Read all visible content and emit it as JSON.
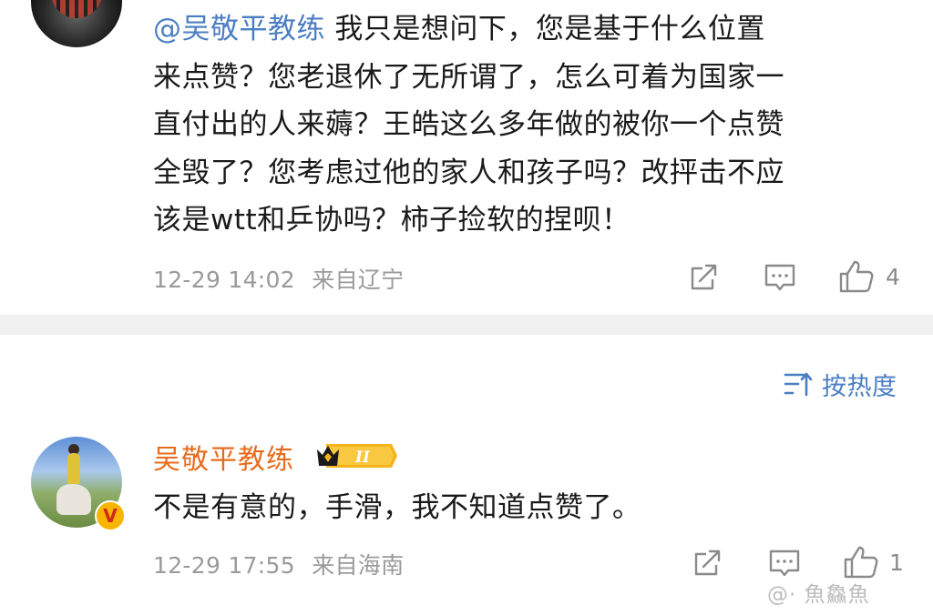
{
  "comment_top": {
    "mention": "@吴敬平教练",
    "line1_rest": " 我只是想问下，您是基于什么位置",
    "line2": "来点赞？您老退休了无所谓了，怎么可着为国家一",
    "line3": "直付出的人来薅？王皓这么多年做的被你一个点赞",
    "line4": "全毁了？您考虑过他的家人和孩子吗？改抨击不应",
    "line5": "该是wtt和乒协吗？柿子捡软的捏呗！",
    "time": "12-29 14:02",
    "location": "来自辽宁",
    "like_count": "4"
  },
  "sort": {
    "label": "按热度"
  },
  "comment_bottom": {
    "username": "吴敬平教练",
    "rank_label": "II",
    "verified_mark": "V",
    "text": "不是有意的，手滑，我不知道点赞了。",
    "time": "12-29 17:55",
    "location": "来自海南",
    "like_count": "1"
  },
  "watermark": "@· 魚鱻魚",
  "colors": {
    "mention": "#4a7ec2",
    "username": "#e86b1c",
    "meta": "#9a9a9a",
    "divider": "#f1f1f1"
  }
}
